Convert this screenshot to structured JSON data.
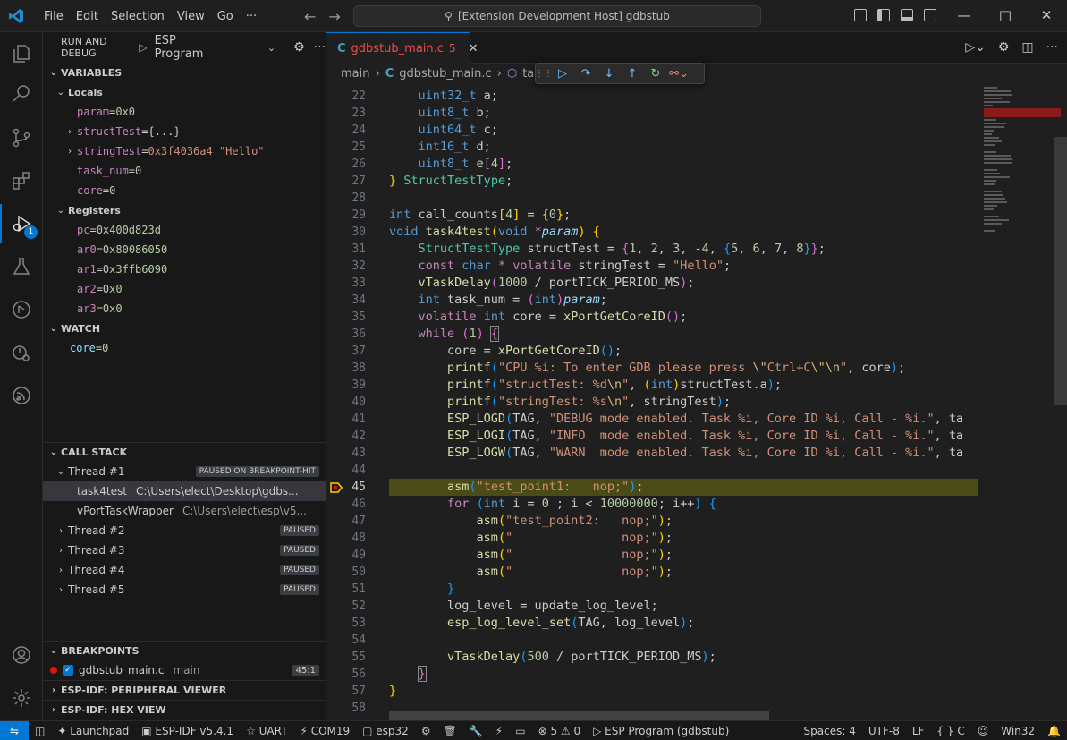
{
  "titlebar": {
    "menu": [
      "File",
      "Edit",
      "Selection",
      "View",
      "Go"
    ],
    "more": "···",
    "search": "[Extension Development Host] gdbstub"
  },
  "sidebar": {
    "title": "RUN AND DEBUG",
    "config": "ESP Program",
    "variables_title": "VARIABLES",
    "locals_title": "Locals",
    "locals": [
      {
        "name": "param",
        "eq": " = ",
        "value": "0x0",
        "expandable": false
      },
      {
        "name": "structTest",
        "eq": " = ",
        "value": "{...}",
        "expandable": true
      },
      {
        "name": "stringTest",
        "eq": " = ",
        "value": "0x3f4036a4 \"Hello\"",
        "expandable": true
      },
      {
        "name": "task_num",
        "eq": " = ",
        "value": "0",
        "expandable": false
      },
      {
        "name": "core",
        "eq": " = ",
        "value": "0",
        "expandable": false
      }
    ],
    "registers_title": "Registers",
    "registers": [
      {
        "name": "pc",
        "eq": " = ",
        "value": "0x400d823d"
      },
      {
        "name": "ar0",
        "eq": " = ",
        "value": "0x80086050"
      },
      {
        "name": "ar1",
        "eq": " = ",
        "value": "0x3ffb6090"
      },
      {
        "name": "ar2",
        "eq": " = ",
        "value": "0x0"
      },
      {
        "name": "ar3",
        "eq": " = ",
        "value": "0x0"
      }
    ],
    "watch_title": "WATCH",
    "watch": [
      {
        "name": "core",
        "eq": " = ",
        "value": "0"
      }
    ],
    "callstack_title": "CALL STACK",
    "thread1": {
      "label": "Thread #1",
      "status": "PAUSED ON BREAKPOINT-HIT"
    },
    "frames": [
      {
        "name": "task4test",
        "path": "C:\\Users\\elect\\Desktop\\gdbs..."
      },
      {
        "name": "vPortTaskWrapper",
        "path": "C:\\Users\\elect\\esp\\v5..."
      }
    ],
    "threads": [
      {
        "label": "Thread #2",
        "status": "PAUSED"
      },
      {
        "label": "Thread #3",
        "status": "PAUSED"
      },
      {
        "label": "Thread #4",
        "status": "PAUSED"
      },
      {
        "label": "Thread #5",
        "status": "PAUSED"
      }
    ],
    "breakpoints_title": "BREAKPOINTS",
    "breakpoint": {
      "file": "gdbstub_main.c",
      "func": "main",
      "pos": "45:1"
    },
    "peripheral_title": "ESP-IDF: PERIPHERAL VIEWER",
    "hexview_title": "ESP-IDF: HEX VIEW",
    "debug_badge": "1"
  },
  "editor": {
    "tab_name": "gdbstub_main.c",
    "tab_problems": "5",
    "breadcrumb": [
      "main",
      "gdbstub_main.c",
      "task4test"
    ],
    "first_line": 22,
    "current_line": 45
  },
  "status": {
    "launchpad": "Launchpad",
    "idf": "ESP-IDF v5.4.1",
    "uart": "UART",
    "port": "COM19",
    "chip": "esp32",
    "errors": "5",
    "warnings": "0",
    "debug_config": "ESP Program (gdbstub)",
    "spaces": "Spaces: 4",
    "encoding": "UTF-8",
    "eol": "LF",
    "lang": "C",
    "platform": "Win32"
  },
  "colors": {
    "accent": "#0078d4",
    "breakpoint": "#e51400",
    "current_line": "#4b4b18"
  }
}
